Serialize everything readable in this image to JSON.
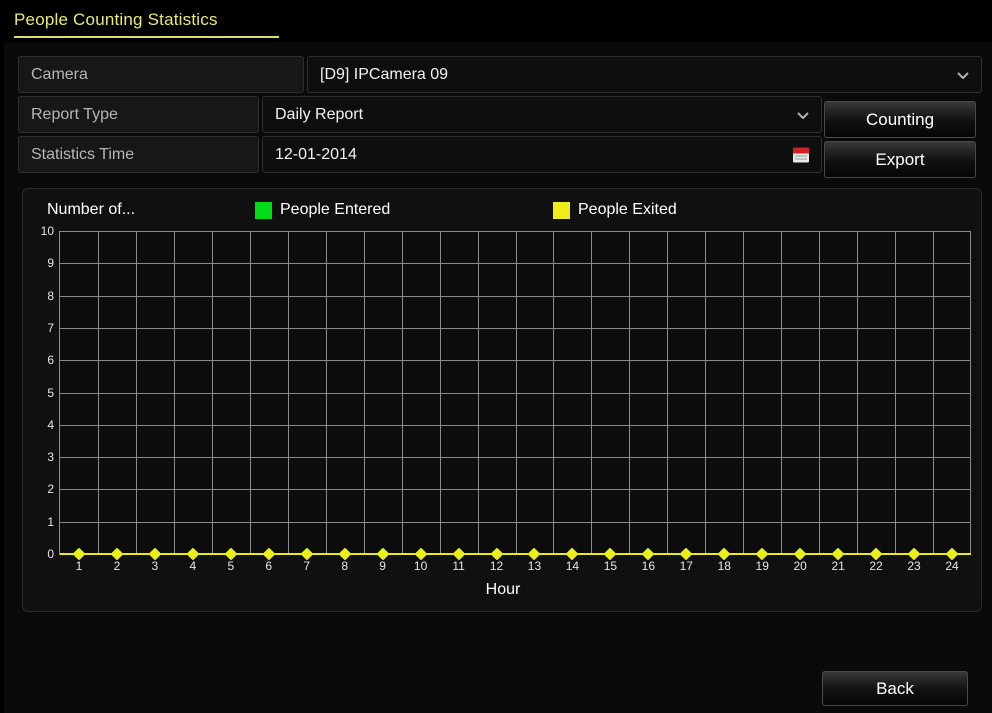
{
  "window": {
    "title": "People Counting Statistics"
  },
  "form": {
    "camera": {
      "label": "Camera",
      "value": "[D9] IPCamera 09",
      "dropdown_icon": "chevron-down-icon"
    },
    "report_type": {
      "label": "Report Type",
      "value": "Daily Report",
      "dropdown_icon": "chevron-down-icon"
    },
    "statistics_time": {
      "label": "Statistics Time",
      "value": "12-01-2014",
      "picker_icon": "calendar-icon"
    }
  },
  "actions": {
    "counting_label": "Counting",
    "export_label": "Export",
    "back_label": "Back"
  },
  "chart_data": {
    "type": "line",
    "title": "",
    "ylabel": "Number of...",
    "xlabel": "Hour",
    "grid": true,
    "legend_position": "top",
    "ylim": [
      0,
      10
    ],
    "yticks": [
      "0",
      "1",
      "2",
      "3",
      "4",
      "5",
      "6",
      "7",
      "8",
      "9",
      "10"
    ],
    "categories": [
      "1",
      "2",
      "3",
      "4",
      "5",
      "6",
      "7",
      "8",
      "9",
      "10",
      "11",
      "12",
      "13",
      "14",
      "15",
      "16",
      "17",
      "18",
      "19",
      "20",
      "21",
      "22",
      "23",
      "24"
    ],
    "series": [
      {
        "name": "People Entered",
        "color": "#00dd16",
        "values": [
          0,
          0,
          0,
          0,
          0,
          0,
          0,
          0,
          0,
          0,
          0,
          0,
          0,
          0,
          0,
          0,
          0,
          0,
          0,
          0,
          0,
          0,
          0,
          0
        ]
      },
      {
        "name": "People Exited",
        "color": "#eded1a",
        "values": [
          0,
          0,
          0,
          0,
          0,
          0,
          0,
          0,
          0,
          0,
          0,
          0,
          0,
          0,
          0,
          0,
          0,
          0,
          0,
          0,
          0,
          0,
          0,
          0
        ]
      }
    ]
  },
  "colors": {
    "accent": "#e8e87a",
    "entered": "#00dd16",
    "exited": "#eded1a",
    "grid": "#8a8a8a"
  }
}
